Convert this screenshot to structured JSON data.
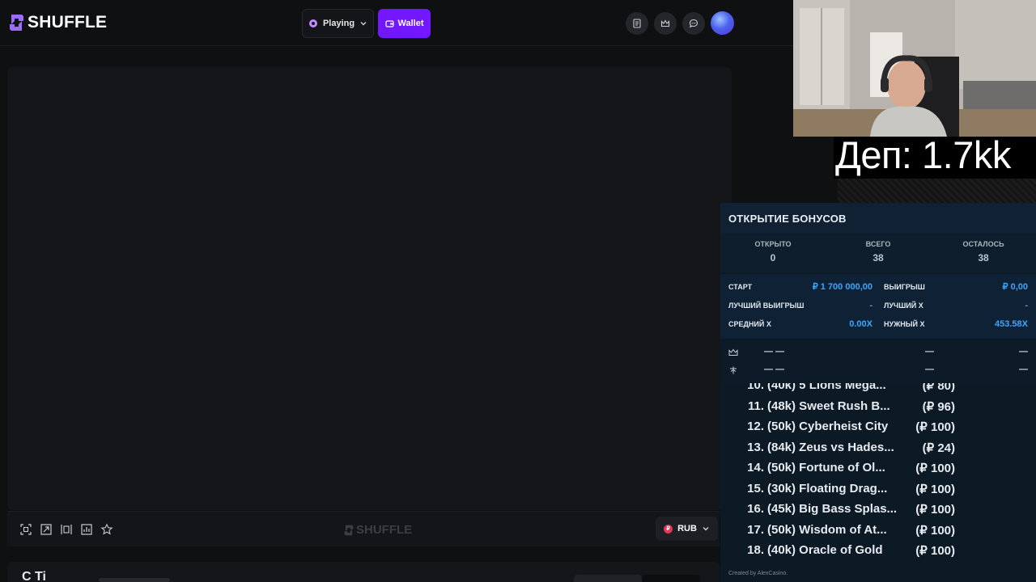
{
  "header": {
    "logo_text": "SHUFFLE",
    "playing_label": "Playing",
    "wallet_label": "Wallet",
    "accent_color": "#7217ff"
  },
  "header_icons": [
    "notes-icon",
    "crown-icon",
    "chat-icon",
    "avatar"
  ],
  "game_toolbar": {
    "logo_text": "SHUFFLE",
    "currency": "RUB",
    "currency_symbol": "₽",
    "icons": [
      "screenshot-icon",
      "fullscreen-icon",
      "theatre-mode-icon",
      "stats-icon",
      "favorite-star-icon"
    ]
  },
  "below_game": {
    "partial_title": "C     Ti"
  },
  "overlay": {
    "deposit_text": "Деп: 1.7kk"
  },
  "bonus_panel": {
    "title": "ОТКРЫТИЕ БОНУСОВ",
    "stats": [
      {
        "label": "ОТКРЫТО",
        "value": "0"
      },
      {
        "label": "ВСЕГО",
        "value": "38"
      },
      {
        "label": "ОСТАЛОСЬ",
        "value": "38"
      }
    ],
    "info": {
      "start_label": "СТАРТ",
      "start_value": "₽ 1 700 000,00",
      "win_label": "ВЫИГРЫШ",
      "win_value": "₽ 0,00",
      "best_win_label": "ЛУЧШИЙ ВЫИГРЫШ",
      "best_win_value": "-",
      "best_x_label": "ЛУЧШИЙ X",
      "best_x_value": "-",
      "avg_x_label": "СРЕДНИЙ X",
      "avg_x_value": "0.00X",
      "needed_x_label": "НУЖНЫЙ X",
      "needed_x_value": "453.58X"
    },
    "best_rows": [
      {
        "icon": "crown-icon",
        "name": "— —",
        "mid": "—",
        "end": "—"
      },
      {
        "icon": "shovel-icon",
        "name": "— —",
        "mid": "—",
        "end": "—"
      }
    ],
    "list": [
      {
        "num": "10.",
        "name": "(40k) 5 Lions Mega...",
        "bet": "(₽ 80)"
      },
      {
        "num": "11.",
        "name": "(48k) Sweet Rush B...",
        "bet": "(₽ 96)"
      },
      {
        "num": "12.",
        "name": "(50k) Cyberheist City",
        "bet": "(₽ 100)"
      },
      {
        "num": "13.",
        "name": "(84k) Zeus vs Hades...",
        "bet": "(₽ 24)"
      },
      {
        "num": "14.",
        "name": "(50k) Fortune of Ol...",
        "bet": "(₽ 100)"
      },
      {
        "num": "15.",
        "name": "(30k) Floating Drag...",
        "bet": "(₽ 100)"
      },
      {
        "num": "16.",
        "name": "(45k) Big Bass Splas...",
        "bet": "(₽ 100)"
      },
      {
        "num": "17.",
        "name": "(50k) Wisdom of At...",
        "bet": "(₽ 100)"
      },
      {
        "num": "18.",
        "name": "(40k) Oracle of Gold",
        "bet": "(₽ 100)"
      }
    ],
    "created_by": "Created by AlexCasino."
  }
}
